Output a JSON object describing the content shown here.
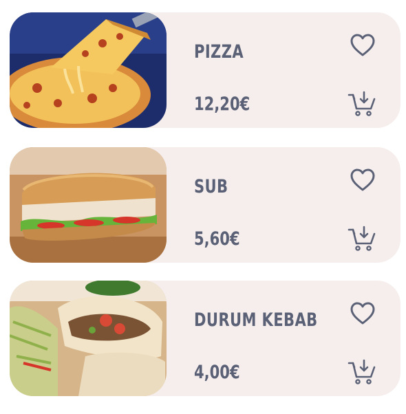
{
  "menu": {
    "items": [
      {
        "name": "PIZZA",
        "price": "12,20€",
        "image": "pizza-photo",
        "favorite_icon": "heart-outline-icon",
        "cart_icon": "add-to-cart-icon"
      },
      {
        "name": "SUB",
        "price": "5,60€",
        "image": "sub-sandwich-photo",
        "favorite_icon": "heart-outline-icon",
        "cart_icon": "add-to-cart-icon"
      },
      {
        "name": "DURUM KEBAB",
        "price": "4,00€",
        "image": "durum-kebab-photo",
        "favorite_icon": "heart-outline-icon",
        "cart_icon": "add-to-cart-icon"
      }
    ]
  },
  "colors": {
    "card_background": "#f6eeec",
    "text": "#5a6075",
    "icon_stroke": "#5a6075"
  }
}
